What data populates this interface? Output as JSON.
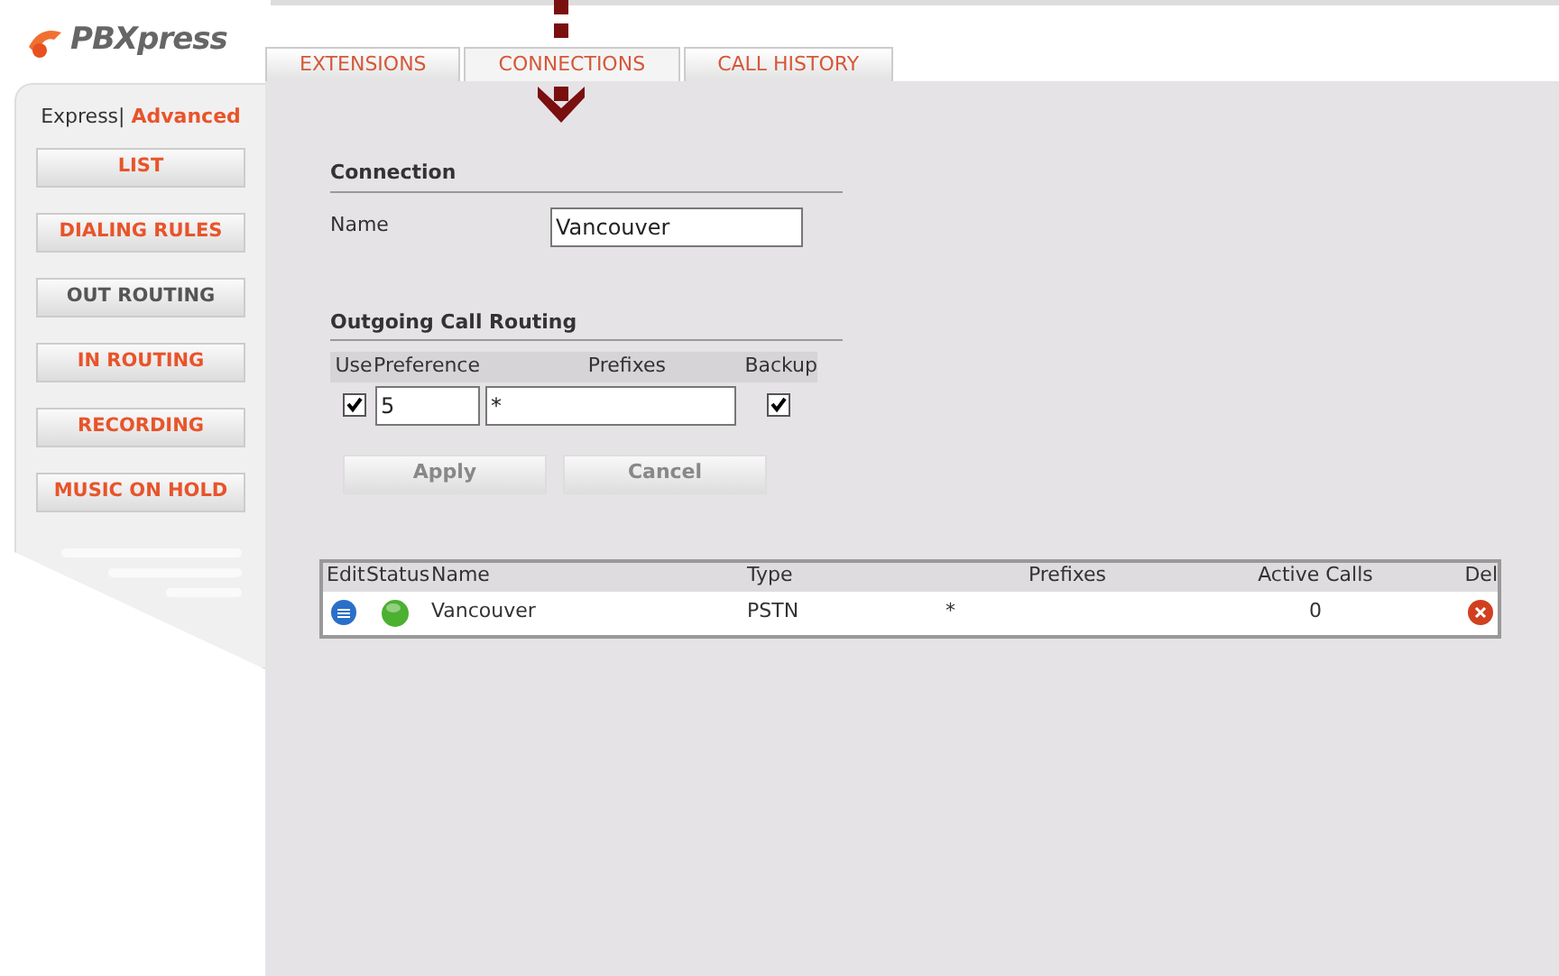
{
  "logo": {
    "text": "PBXpress"
  },
  "tabs": [
    {
      "label": "EXTENSIONS",
      "selected": false
    },
    {
      "label": "CONNECTIONS",
      "selected": true
    },
    {
      "label": "CALL HISTORY",
      "selected": false
    }
  ],
  "mode_switch": {
    "separator": "|",
    "options": [
      {
        "label": "Express",
        "selected": false
      },
      {
        "label": "Advanced",
        "selected": true
      }
    ]
  },
  "sidebar": {
    "items": [
      {
        "label": "LIST",
        "selected": false
      },
      {
        "label": "DIALING RULES",
        "selected": false
      },
      {
        "label": "OUT ROUTING",
        "selected": true
      },
      {
        "label": "IN ROUTING",
        "selected": false
      },
      {
        "label": "RECORDING",
        "selected": false
      },
      {
        "label": "MUSIC ON HOLD",
        "selected": false
      }
    ]
  },
  "connection": {
    "title": "Connection",
    "name_label": "Name",
    "name_value": "Vancouver"
  },
  "routing": {
    "title": "Outgoing Call Routing",
    "columns": [
      "Use",
      "Preference",
      "Prefixes",
      "Backup"
    ],
    "row": {
      "use": true,
      "preference": "5",
      "prefixes": "*",
      "backup": true
    }
  },
  "buttons": [
    "Apply",
    "Cancel"
  ],
  "table": {
    "columns": [
      "Edit",
      "Status",
      "Name",
      "Type",
      "Prefixes",
      "Active Calls",
      "Del"
    ],
    "rows": [
      {
        "online": true,
        "name": "Vancouver",
        "type": "PSTN",
        "prefixes": "*",
        "active_calls": "0"
      }
    ]
  }
}
